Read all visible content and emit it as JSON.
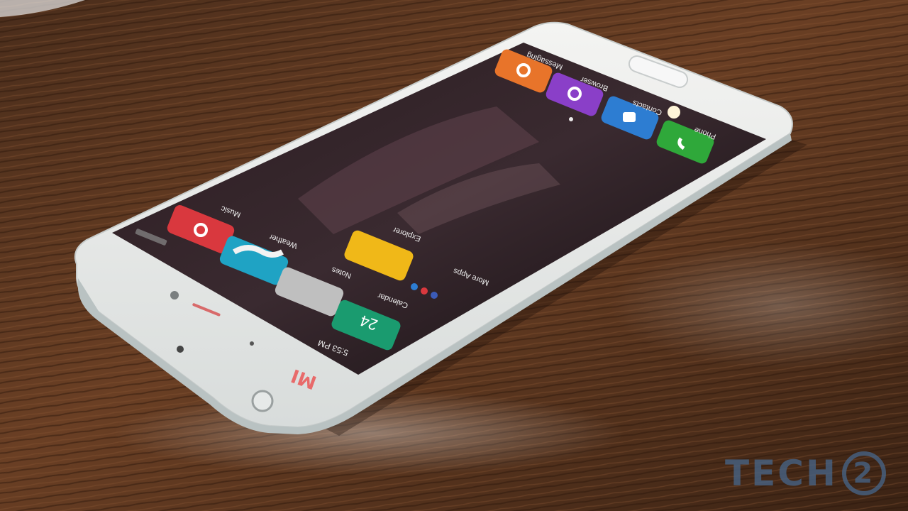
{
  "status_bar": {
    "time": "5:53 PM"
  },
  "dock": [
    {
      "label": "Phone",
      "icon": "phone-icon",
      "color": "#2fa83a"
    },
    {
      "label": "Contacts",
      "icon": "contacts-icon",
      "color": "#2d7dd2"
    },
    {
      "label": "Browser",
      "icon": "browser-icon",
      "color": "#8a3fc8"
    },
    {
      "label": "Messaging",
      "icon": "messaging-icon",
      "color": "#e8742a"
    }
  ],
  "home_apps": [
    {
      "label": "Music",
      "icon": "music-icon",
      "color": "#d9383e"
    },
    {
      "label": "Weather",
      "icon": "weather-icon",
      "color": "#1fa3c4"
    },
    {
      "label": "Notes",
      "icon": "notes-icon",
      "color": "#bfbfbf"
    },
    {
      "label": "Calendar",
      "icon": "calendar-icon",
      "color": "#1a9b6f",
      "value": "24"
    },
    {
      "label": "Explorer",
      "icon": "folder-icon",
      "color": "#f0b818"
    },
    {
      "label": "More Apps",
      "icon": "more-apps-folder-icon",
      "color": "#333333"
    }
  ],
  "phone_brand": "MI",
  "watermark": {
    "text": "TECH",
    "ring_text": "2"
  }
}
